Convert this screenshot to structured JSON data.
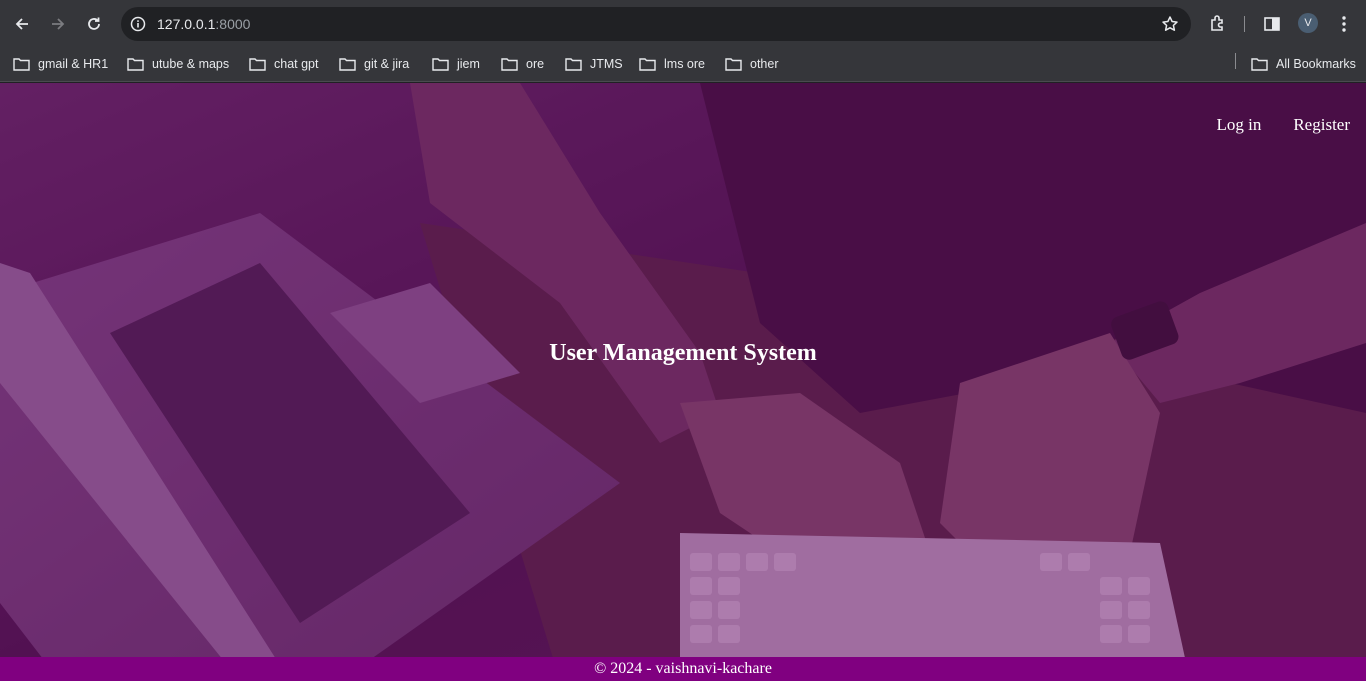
{
  "browser": {
    "url_host": "127.0.0.1",
    "url_port": ":8000",
    "avatar_initial": "V",
    "icons": [
      "back-arrow-icon",
      "forward-arrow-icon",
      "reload-icon",
      "site-info-icon",
      "star-icon",
      "extensions-icon",
      "side-panel-icon",
      "menu-dots-icon",
      "folder-icon"
    ]
  },
  "bookmarks": {
    "items": [
      {
        "label": "gmail & HR1"
      },
      {
        "label": "utube & maps"
      },
      {
        "label": "chat gpt"
      },
      {
        "label": "git & jira"
      },
      {
        "label": "jiem"
      },
      {
        "label": "ore"
      },
      {
        "label": "JTMS"
      },
      {
        "label": "lms ore"
      },
      {
        "label": "other"
      }
    ],
    "all_bookmarks": "All Bookmarks"
  },
  "page": {
    "nav": {
      "login": "Log in",
      "register": "Register"
    },
    "title": "User Management System",
    "footer": "© 2024 - vaishnavi-kachare"
  },
  "colors": {
    "overlay": "#6e146e",
    "footer": "#800080",
    "chrome": "#35363a",
    "omnibox": "#202124"
  }
}
